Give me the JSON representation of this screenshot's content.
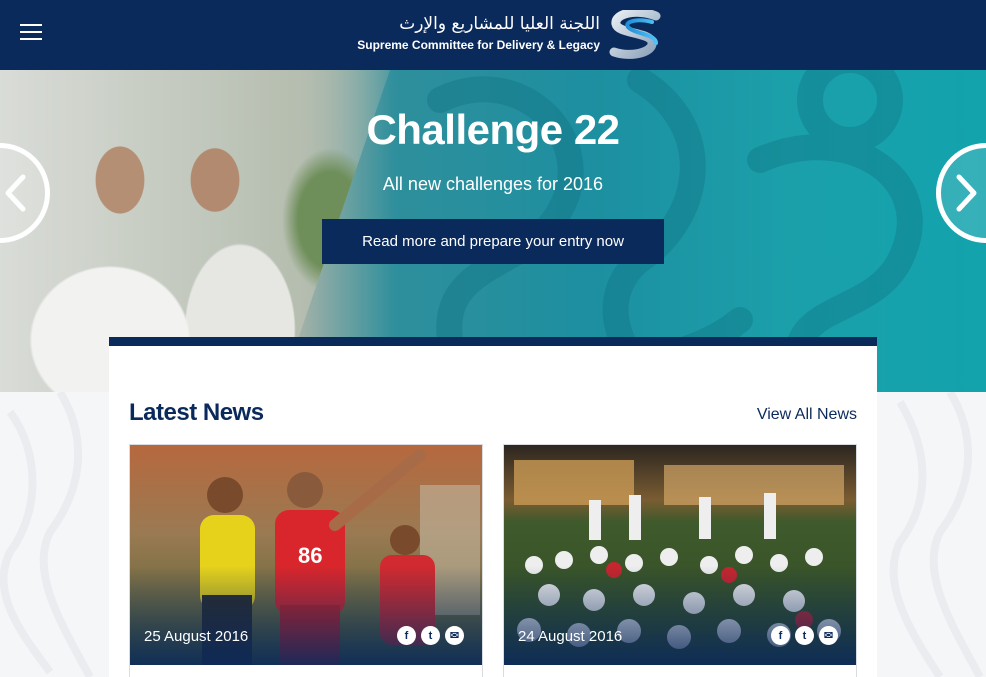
{
  "header": {
    "logo_ar": "اللجنة العليا للمشاريع والإرث",
    "logo_en": "Supreme Committee for Delivery & Legacy",
    "menu_icon": "hamburger-icon",
    "brand_color": "#0b2a5c"
  },
  "hero": {
    "title": "Challenge 22",
    "subtitle": "All new challenges for 2016",
    "cta_label": "Read more and prepare your entry now",
    "prev_icon": "chevron-left-icon",
    "next_icon": "chevron-right-icon",
    "accent_color": "#1ba0aa"
  },
  "news": {
    "title": "Latest News",
    "view_all_label": "View All News",
    "items": [
      {
        "date": "25 August 2016",
        "share": [
          "f",
          "t",
          "✉"
        ]
      },
      {
        "date": "24 August 2016",
        "share": [
          "f",
          "t",
          "✉"
        ]
      }
    ]
  }
}
